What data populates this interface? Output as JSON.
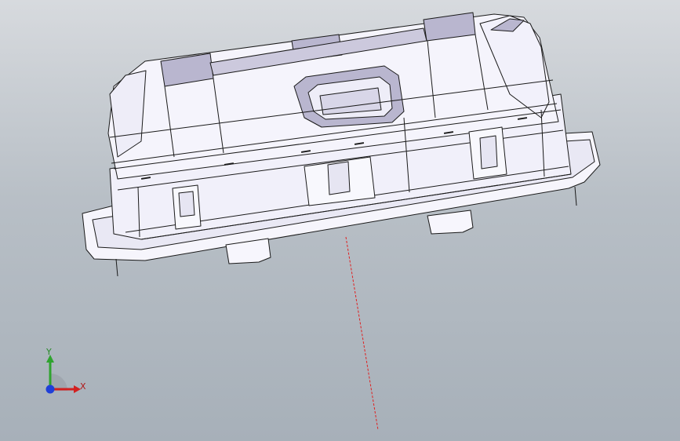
{
  "viewport": {
    "background_top": "#d7dade",
    "background_bottom": "#a7b0b9"
  },
  "model": {
    "icon": "cad-part-housing",
    "body_color": "#f3f2fb",
    "shade_color": "#b9b6cf",
    "edge_color": "#1a1a1a"
  },
  "sketch_line": {
    "color": "#e02020"
  },
  "triad": {
    "y_label": "Y",
    "x_label": "X",
    "y_color": "#2fa32f",
    "x_color": "#d22020",
    "z_color": "#1f3fd8"
  }
}
